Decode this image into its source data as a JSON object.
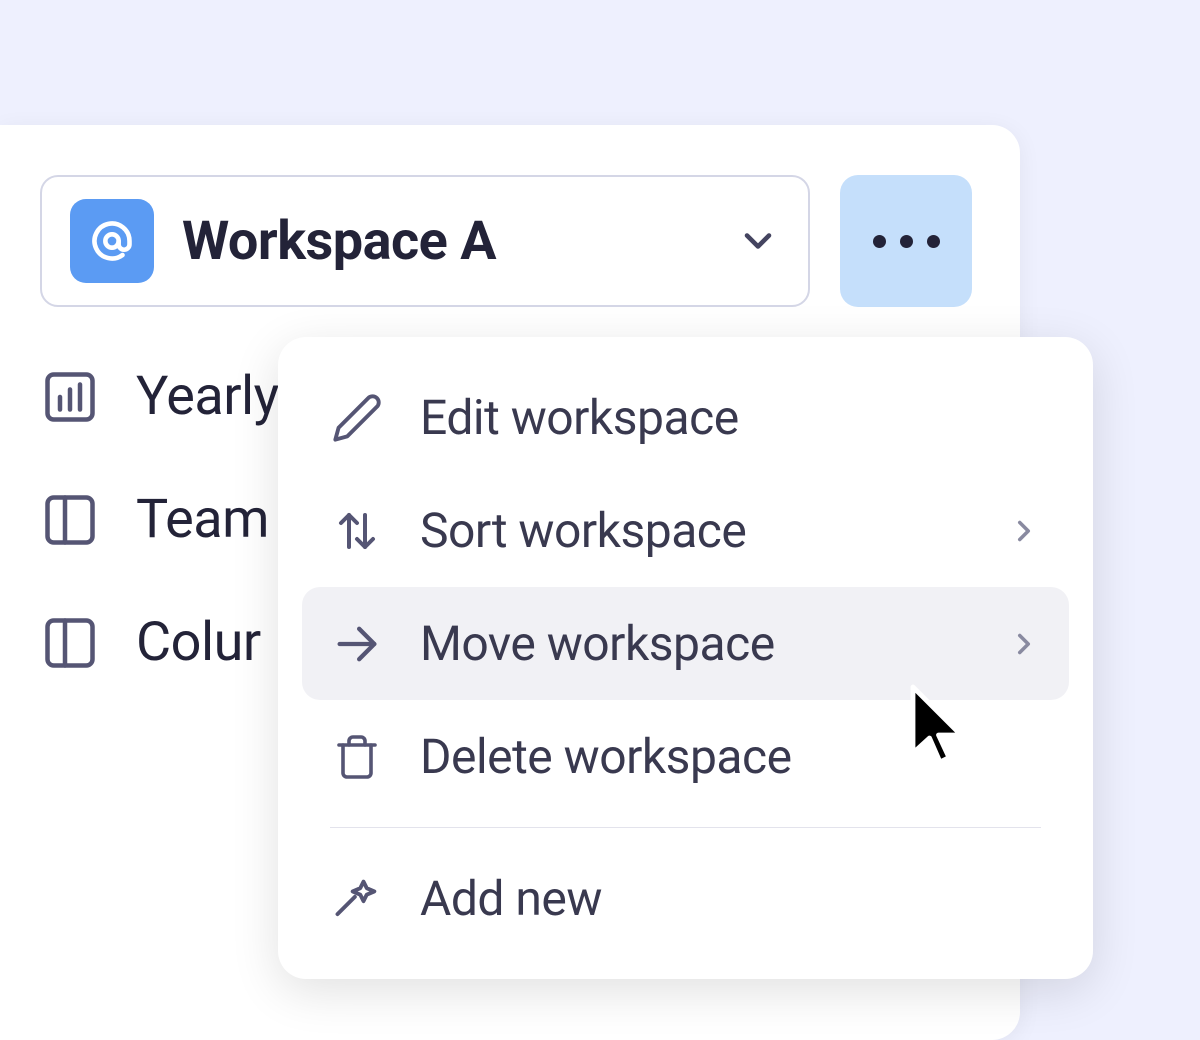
{
  "workspace": {
    "name": "Workspace A",
    "icon": "at-icon"
  },
  "nav": {
    "items": [
      {
        "label": "Yearly",
        "icon": "bar-chart-icon"
      },
      {
        "label": "Team",
        "icon": "panel-left-icon"
      },
      {
        "label": "Colur",
        "icon": "panel-left-icon"
      }
    ]
  },
  "menu": {
    "items": [
      {
        "label": "Edit workspace",
        "icon": "pencil-icon",
        "hasSubmenu": false
      },
      {
        "label": "Sort workspace",
        "icon": "sort-icon",
        "hasSubmenu": true
      },
      {
        "label": "Move workspace",
        "icon": "arrow-right-icon",
        "hasSubmenu": true,
        "highlighted": true
      },
      {
        "label": "Delete workspace",
        "icon": "trash-icon",
        "hasSubmenu": false
      }
    ],
    "addNew": "Add new"
  }
}
